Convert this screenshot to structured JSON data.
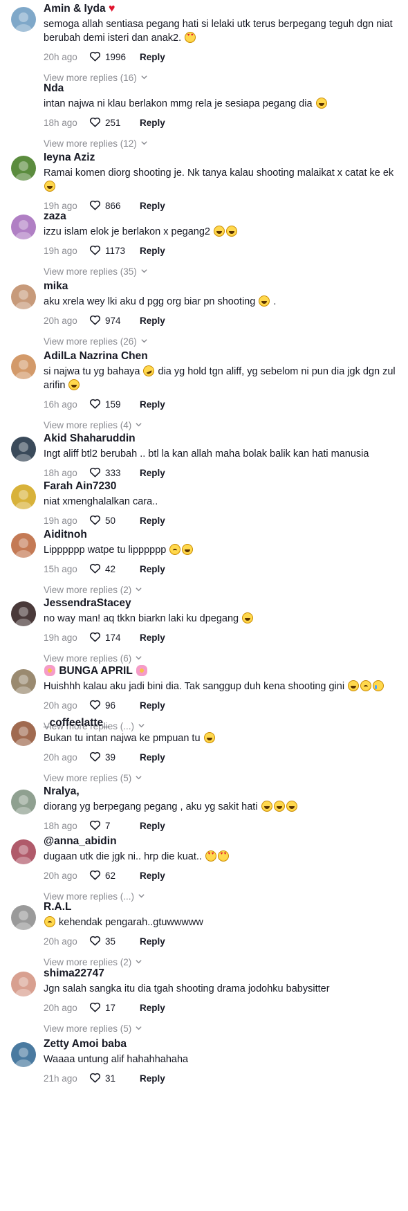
{
  "comments": [
    {
      "author": "Amin & Iyda",
      "author_suffix": "♥",
      "text": "semoga allah sentiasa pegang hati si lelaki utk terus berpegang teguh dgn niat berubah demi isteri dan anak2.",
      "emoji": [
        "love-face"
      ],
      "time": "20h ago",
      "likes": "1996",
      "reply": "Reply",
      "more": "View more replies (16)",
      "avatar_color": "#7fa8c9"
    },
    {
      "author": "Nda",
      "text": "intan najwa ni klau berlakon mmg rela je sesiapa pegang dia",
      "emoji": [
        "grin"
      ],
      "time": "18h ago",
      "likes": "251",
      "reply": "Reply",
      "more": "View more replies (12)",
      "avatar_color": "#ffffff"
    },
    {
      "author": "Ieyna Aziz",
      "text": "Ramai komen diorg shooting je. Nk tanya kalau shooting malaikat x catat ke ek",
      "emoji": [
        "grin"
      ],
      "time": "19h ago",
      "likes": "866",
      "reply": "Reply",
      "more": "",
      "avatar_color": "#5b8c3e"
    },
    {
      "author": "zaza",
      "text": "izzu islam elok je berlakon x pegang2",
      "emoji": [
        "grin",
        "grin"
      ],
      "time": "19h ago",
      "likes": "1173",
      "reply": "Reply",
      "more": "View more replies (35)",
      "avatar_color": "#b07fc4"
    },
    {
      "author": "mika",
      "text": "aku xrela wey lki aku d pgg org biar pn shooting",
      "emoji": [
        "grin"
      ],
      "text_after": " .",
      "time": "20h ago",
      "likes": "974",
      "reply": "Reply",
      "more": "View more replies (26)",
      "avatar_color": "#c79a7a"
    },
    {
      "author": "AdilLa Nazrina Chen",
      "text": "si najwa tu yg bahaya",
      "emoji": [
        "roll"
      ],
      "text_after": " dia yg hold tgn aliff, yg sebelom ni pun dia jgk dgn zul arifin",
      "emoji_after": [
        "grin"
      ],
      "time": "16h ago",
      "likes": "159",
      "reply": "Reply",
      "more": "View more replies (4)",
      "avatar_color": "#d39a6a"
    },
    {
      "author": "Akid Shaharuddin",
      "text": "Ingt aliff btl2 berubah .. btl la kan allah maha bolak balik kan hati manusia",
      "emoji": [],
      "time": "18h ago",
      "likes": "333",
      "reply": "Reply",
      "more": "",
      "avatar_color": "#3a4a5a"
    },
    {
      "author": "Farah Ain7230",
      "text": "niat xmenghalalkan cara..",
      "emoji": [],
      "time": "19h ago",
      "likes": "50",
      "reply": "Reply",
      "more": "",
      "avatar_color": "#d8b23a"
    },
    {
      "author": "Aiditnoh",
      "text": "Lipppppp watpe tu lipppppp",
      "emoji": [
        "sad",
        "grin"
      ],
      "time": "15h ago",
      "likes": "42",
      "reply": "Reply",
      "more": "View more replies (2)",
      "avatar_color": "#c47a55"
    },
    {
      "author": "JessendraStacey",
      "text": "no way man! aq tkkn biarkn laki ku dpegang",
      "emoji": [
        "grin"
      ],
      "time": "19h ago",
      "likes": "174",
      "reply": "Reply",
      "more": "View more replies (6)",
      "avatar_color": "#4a3a3a"
    },
    {
      "author": "BUNGA APRIL",
      "author_prefix_emoji": "flower",
      "author_suffix_emoji": "flower",
      "text": "Huishhh kalau aku jadi bini dia. Tak sanggup duh kena shooting gini",
      "emoji": [
        "grin",
        "sad",
        "cry"
      ],
      "time": "20h ago",
      "likes": "96",
      "reply": "Reply",
      "more": "View more replies (...)",
      "avatar_color": "#9a8a70"
    },
    {
      "author": "_coffeelatte_",
      "text": "Bukan tu intan najwa ke pmpuan tu",
      "emoji": [
        "grin"
      ],
      "time": "20h ago",
      "likes": "39",
      "reply": "Reply",
      "more": "View more replies (5)",
      "avatar_color": "#a06a50"
    },
    {
      "author": "Nralya,",
      "text": "diorang yg berpegang pegang , aku yg sakit hati",
      "emoji": [
        "grin",
        "grin",
        "grin"
      ],
      "time": "18h ago",
      "likes": "7",
      "reply": "Reply",
      "more": "",
      "avatar_color": "#8fa090"
    },
    {
      "author": "@anna_abidin",
      "text": "dugaan utk die jgk ni.. hrp die kuat..",
      "emoji": [
        "love-face",
        "love-face"
      ],
      "time": "20h ago",
      "likes": "62",
      "reply": "Reply",
      "more": "View more replies (...)",
      "avatar_color": "#b05a6a"
    },
    {
      "author": "R.A.L",
      "text": "kehendak pengarah..gtuwwwww",
      "emoji_before": [
        "sad"
      ],
      "emoji": [],
      "time": "20h ago",
      "likes": "35",
      "reply": "Reply",
      "more": "View more replies (2)",
      "avatar_color": "#9a9a9a"
    },
    {
      "author": "shima22747",
      "text": "Jgn salah sangka itu dia tgah shooting drama jodohku babysitter",
      "emoji": [],
      "time": "20h ago",
      "likes": "17",
      "reply": "Reply",
      "more": "View more replies (5)",
      "avatar_color": "#d8a090"
    },
    {
      "author": "Zetty Amoi baba",
      "text": "Waaaa untung alif hahahhahaha",
      "emoji": [],
      "time": "21h ago",
      "likes": "31",
      "reply": "Reply",
      "more": "",
      "avatar_color": "#4a7aa0"
    }
  ],
  "icons": {
    "like": "heart-outline-icon",
    "more": "chevron-down-icon"
  }
}
